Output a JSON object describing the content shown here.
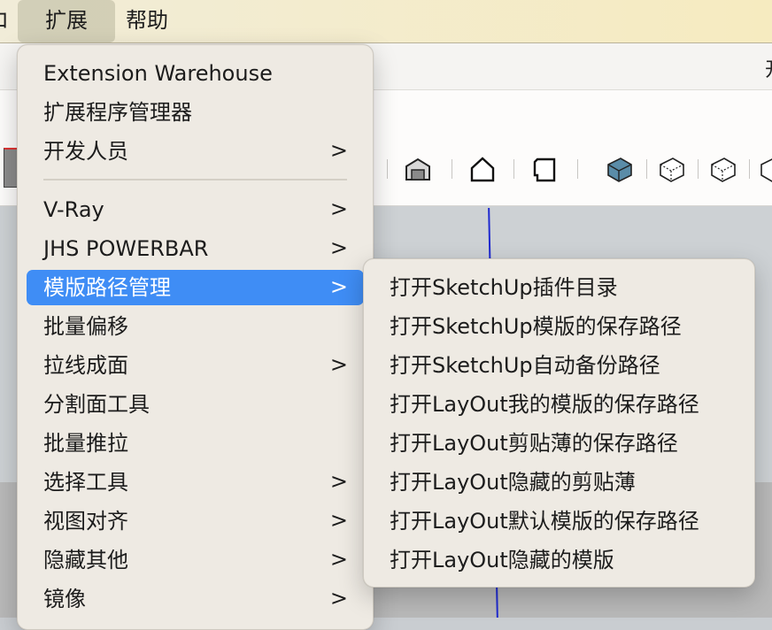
{
  "menubar": {
    "items": [
      "ロ",
      "扩展",
      "帮助"
    ]
  },
  "window": {
    "title_fragment": "开"
  },
  "main_menu": {
    "items": [
      {
        "label": "Extension Warehouse",
        "has_submenu": false
      },
      {
        "label": "扩展程序管理器",
        "has_submenu": false
      },
      {
        "label": "开发人员",
        "has_submenu": true
      },
      {
        "label": "V-Ray",
        "has_submenu": true
      },
      {
        "label": "JHS POWERBAR",
        "has_submenu": true
      },
      {
        "label": "模版路径管理",
        "has_submenu": true,
        "selected": true
      },
      {
        "label": "批量偏移",
        "has_submenu": false
      },
      {
        "label": "拉线成面",
        "has_submenu": true
      },
      {
        "label": "分割面工具",
        "has_submenu": false
      },
      {
        "label": "批量推拉",
        "has_submenu": false
      },
      {
        "label": "选择工具",
        "has_submenu": true
      },
      {
        "label": "视图对齐",
        "has_submenu": true
      },
      {
        "label": "隐藏其他",
        "has_submenu": true
      },
      {
        "label": "镜像",
        "has_submenu": true
      }
    ],
    "chevron": ">"
  },
  "submenu": {
    "items": [
      "打开SketchUp插件目录",
      "打开SketchUp模版的保存路径",
      "打开SketchUp自动备份路径",
      "打开LayOut我的模版的保存路径",
      "打开LayOut剪贴薄的保存路径",
      "打开LayOut隐藏的剪贴薄",
      "打开LayOut默认模版的保存路径",
      "打开LayOut隐藏的模版"
    ]
  },
  "toolbar": {
    "icons": [
      "warehouse-icon",
      "home-view-icon",
      "front-view-icon",
      "iso-view-icon",
      "top-view-icon",
      "right-view-icon",
      "back-view-icon"
    ]
  },
  "colors": {
    "selection": "#3f8df5",
    "menu_bg": "#eeeae3",
    "menubar_bg": "#f6ebc0",
    "axis_blue": "#1f2ad0"
  }
}
